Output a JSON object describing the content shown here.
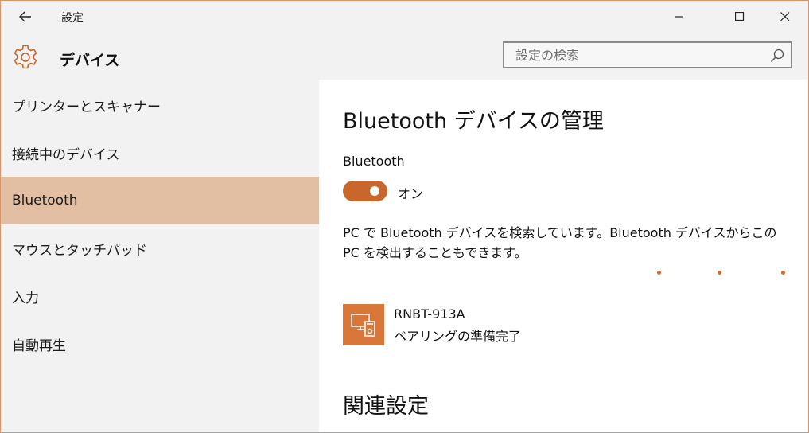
{
  "window": {
    "title": "設定",
    "accent_color": "#c8662c",
    "selected_color": "#e2bfa3"
  },
  "header": {
    "icon": "gear-icon",
    "title": "デバイス",
    "search": {
      "placeholder": "設定の検索",
      "value": ""
    }
  },
  "sidebar": {
    "items": [
      {
        "label": "プリンターとスキャナー",
        "selected": false
      },
      {
        "label": "接続中のデバイス",
        "selected": false
      },
      {
        "label": "Bluetooth",
        "selected": true
      },
      {
        "label": "マウスとタッチパッド",
        "selected": false
      },
      {
        "label": "入力",
        "selected": false
      },
      {
        "label": "自動再生",
        "selected": false
      }
    ]
  },
  "main": {
    "title": "Bluetooth デバイスの管理",
    "bluetooth_label": "Bluetooth",
    "toggle": {
      "state": "オン",
      "on": true
    },
    "description": "PC で Bluetooth デバイスを検索しています。Bluetooth デバイスからこの PC を検出することもできます。",
    "device": {
      "icon": "devices-icon",
      "name": "RNBT-913A",
      "status": "ペアリングの準備完了"
    },
    "related_title": "関連設定"
  }
}
